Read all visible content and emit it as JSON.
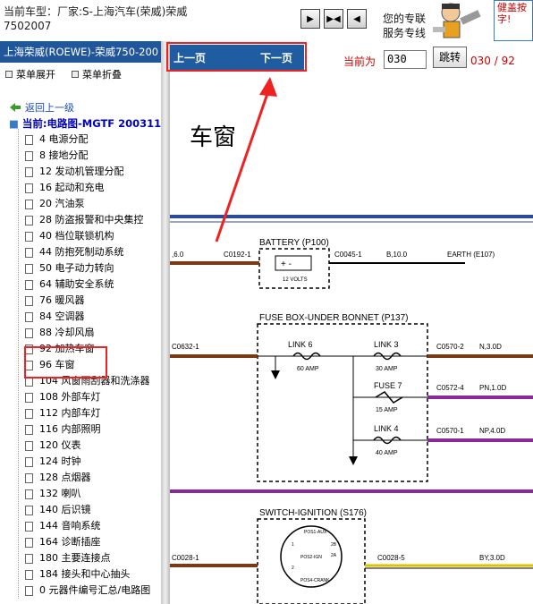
{
  "top": {
    "car_model_line1": "当前车型：厂家:S-上海汽车(荣威)荣威",
    "car_model_line2": "7502007",
    "service_line1": "您的专联",
    "service_line2": "服务专线",
    "ad_text": "健盖按字!"
  },
  "left": {
    "car_bar": "上海荣威(ROEWE)-荣威750-200",
    "expand_label": "菜单展开",
    "collapse_label": "菜单折叠",
    "back_label": "返回上一级",
    "current_label": "当前:电路图-MGTF 200311",
    "items": [
      "4 电源分配",
      "8 接地分配",
      "12 发动机管理分配",
      "16 起动和充电",
      "20 汽油泵",
      "28 防盗报警和中央集控",
      "40 档位联锁机构",
      "44 防抱死制动系统",
      "50 电子动力转向",
      "64 辅助安全系统",
      "76 暖风器",
      "84 空调器",
      "88 冷却风扇",
      "92 加热车窗",
      "96 车窗",
      "104 风窗雨刮器和洗涤器",
      "108 外部车灯",
      "112 内部车灯",
      "116 内部照明",
      "120 仪表",
      "124 时钟",
      "128 点烟器",
      "132 喇叭",
      "140 后识镜",
      "144 音响系统",
      "164 诊断插座",
      "180 主要连接点",
      "184 接头和中心抽头",
      "0 元器件编号汇总/电路图"
    ]
  },
  "pager": {
    "prev_label": "上一页",
    "next_label": "下一页",
    "current_prefix": "当前为",
    "page_value": "030",
    "jump_label": "跳转",
    "page_info": "030 / 92"
  },
  "diagram": {
    "title": "车窗",
    "battery_label": "BATTERY (P100)",
    "fuse_box_label": "FUSE BOX-UNDER BONNET (P137)",
    "switch_label": "SWITCH-IGNITION (S176)",
    "volts_label": "12 VOLTS",
    "left_wire": ",6.0",
    "c0192": "C0192-1",
    "c0045": "C0045-1",
    "b10": "B,10.0",
    "earth": "EARTH (E107)",
    "c0632": "C0632-1",
    "link6": "LINK 6",
    "link6_amp": "60 AMP",
    "link3": "LINK 3",
    "link3_amp": "30 AMP",
    "fuse7": "FUSE 7",
    "fuse7_amp": "15 AMP",
    "link4": "LINK 4",
    "link4_amp": "40 AMP",
    "c0570_2": "C0570-2",
    "n30": "N,3.0D",
    "c0572_4": "C0572-4",
    "pn10": "PN,1.0D",
    "c0570_1": "C0570-1",
    "np40": "NP,4.0D",
    "c0028_1": "C0028-1",
    "c0028_5": "C0028-5",
    "by30": "BY,3.0D",
    "pos_aux": "POS1-AUX",
    "pos_ign": "POS2-IGN",
    "pos_crank": "POS4-CRANK",
    "pins": [
      "2B",
      "2A",
      "1",
      "2"
    ]
  },
  "colors": {
    "accent_blue": "#1f5ca0",
    "highlight_red": "#e22222",
    "wire_brown": "#7a3a14",
    "wire_purple": "#8a2a9a",
    "wire_yellow": "#d8c400"
  }
}
